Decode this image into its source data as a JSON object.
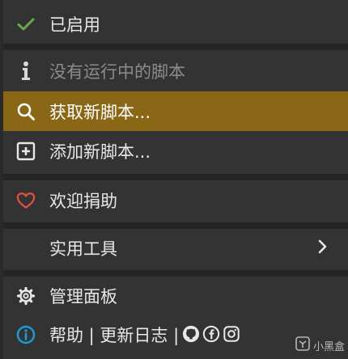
{
  "menu": {
    "enabled": {
      "label": "已启用",
      "icon": "check-icon"
    },
    "no_scripts": {
      "label": "没有运行中的脚本",
      "icon": "info-icon"
    },
    "get_scripts": {
      "label": "获取新脚本...",
      "icon": "search-icon"
    },
    "add_script": {
      "label": "添加新脚本...",
      "icon": "plus-box-icon"
    },
    "donate": {
      "label": "欢迎捐助",
      "icon": "heart-icon"
    },
    "utilities": {
      "label": "实用工具",
      "icon": "chevron-right-icon"
    },
    "dashboard": {
      "label": "管理面板",
      "icon": "gear-icon"
    },
    "help": {
      "label": "帮助 | 更新日志 |",
      "icon": "info-circle-icon"
    }
  },
  "watermark": {
    "text": "小黑盒"
  },
  "colors": {
    "background": "#333333",
    "highlight": "#8a6717",
    "check": "#6aa84f",
    "heart": "#e0533d",
    "info": "#1e9bd7"
  }
}
